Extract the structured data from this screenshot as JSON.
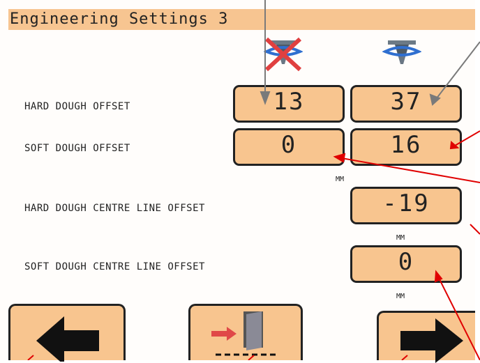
{
  "header": {
    "title": "Engineering Settings 3"
  },
  "columns": {
    "col1_icon": "depositor-head-crossed-icon",
    "col2_icon": "depositor-head-icon"
  },
  "rows": {
    "hard_offset": {
      "label": "HARD DOUGH OFFSET",
      "value1": "13",
      "value2": "37"
    },
    "soft_offset": {
      "label": "SOFT DOUGH OFFSET",
      "value1": "0",
      "value2": "16",
      "unit": "MM"
    },
    "hard_centre": {
      "label": "HARD DOUGH CENTRE LINE OFFSET",
      "value": "-19",
      "unit": "MM"
    },
    "soft_centre": {
      "label": "SOFT DOUGH CENTRE LINE OFFSET",
      "value": "0",
      "unit": "MM"
    }
  },
  "buttons": {
    "back_icon": "left-arrow-icon",
    "exit_icon": "exit-door-icon",
    "next_icon": "right-arrow-icon"
  },
  "colors": {
    "panel": "#f8c58f",
    "title_bar": "#f7c591",
    "annotation": "#e00000"
  }
}
